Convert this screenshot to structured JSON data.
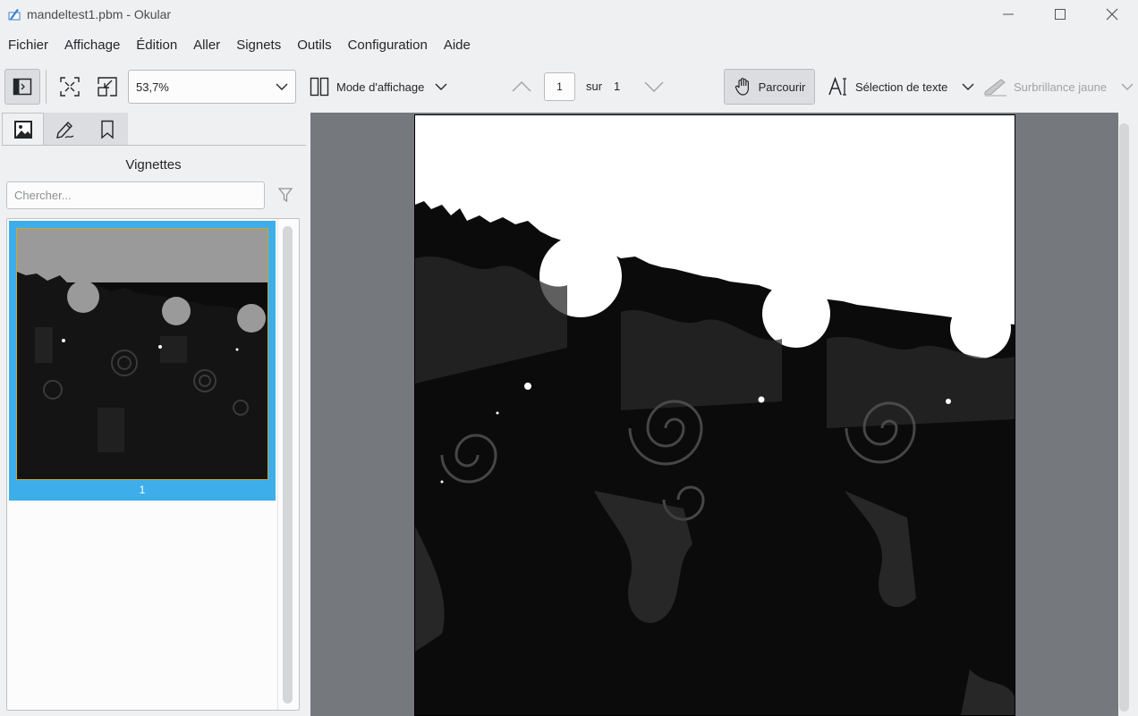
{
  "window": {
    "title": "mandeltest1.pbm  - Okular"
  },
  "menubar": {
    "items": [
      "Fichier",
      "Affichage",
      "Édition",
      "Aller",
      "Signets",
      "Outils",
      "Configuration",
      "Aide"
    ]
  },
  "toolbar": {
    "zoom_value": "53,7%",
    "view_mode_label": "Mode d'affichage",
    "page_current": "1",
    "page_of_label": "sur",
    "page_total": "1",
    "browse_label": "Parcourir",
    "text_select_label": "Sélection de texte",
    "highlight_label": "Surbrillance jaune"
  },
  "sidebar": {
    "tabs": [
      "thumbnails-tab",
      "annotations-tab",
      "bookmarks-tab"
    ],
    "title": "Vignettes",
    "search_placeholder": "Chercher...",
    "thumbnails": [
      {
        "label": "1"
      }
    ]
  },
  "colors": {
    "accent": "#3daee9",
    "window_bg": "#eff0f1",
    "viewer_bg": "#75787d"
  }
}
